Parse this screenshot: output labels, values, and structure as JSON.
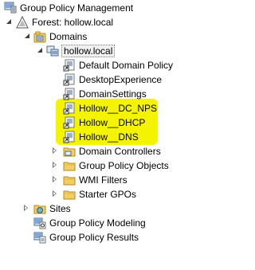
{
  "tree": {
    "root": "Group Policy Management",
    "forest": "Forest: hollow.local",
    "domains": "Domains",
    "domain": "hollow.local",
    "gpo_links": [
      "Default Domain Policy",
      "DesktopExperience",
      "DomainSettings",
      "Hollow__DC_NPS",
      "Hollow__DHCP",
      "Hollow__DNS"
    ],
    "containers": [
      "Domain Controllers",
      "Group Policy Objects",
      "WMI Filters",
      "Starter GPOs"
    ],
    "sites": "Sites",
    "modeling": "Group Policy Modeling",
    "results": "Group Policy Results"
  },
  "highlight": {
    "color": "#f4f400",
    "items": [
      "Hollow__DC_NPS",
      "Hollow__DHCP",
      "Hollow__DNS"
    ]
  }
}
